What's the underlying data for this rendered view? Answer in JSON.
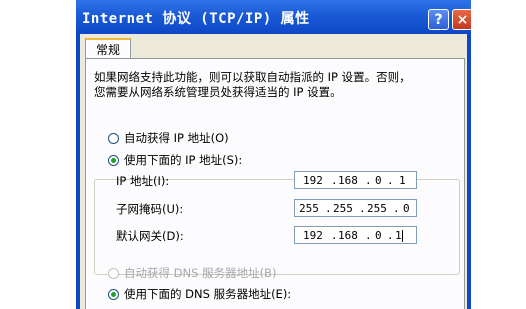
{
  "window": {
    "title": "Internet 协议 (TCP/IP) 属性",
    "help_label": "?",
    "close_label": "×"
  },
  "tab": {
    "label": "常规"
  },
  "description": {
    "line1": "如果网络支持此功能，则可以获取自动指派的 IP 设置。否则，",
    "line2": "您需要从网络系统管理员处获得适当的 IP 设置。"
  },
  "ip_options": {
    "auto": {
      "label": "自动获得 IP 地址(O)",
      "selected": false
    },
    "manual": {
      "label": "使用下面的 IP 地址(S):",
      "selected": true
    }
  },
  "fields": {
    "ip": {
      "label": "IP 地址(I):",
      "octets": [
        "192",
        "168",
        "0",
        "1"
      ]
    },
    "mask": {
      "label": "子网掩码(U):",
      "octets": [
        "255",
        "255",
        "255",
        "0"
      ]
    },
    "gateway": {
      "label": "默认网关(D):",
      "octets": [
        "192",
        "168",
        "0",
        "1"
      ]
    }
  },
  "dns_options": {
    "auto": {
      "label": "自动获得 DNS 服务器地址(B)",
      "selected": false,
      "disabled": true
    },
    "manual_partial": {
      "label": "使用下面的 DNS 服务器地址(E):",
      "selected": true
    }
  },
  "colors": {
    "titlebar": "#0d48c6",
    "dialog_bg": "#ece9d8",
    "close_button": "#c3391c"
  }
}
